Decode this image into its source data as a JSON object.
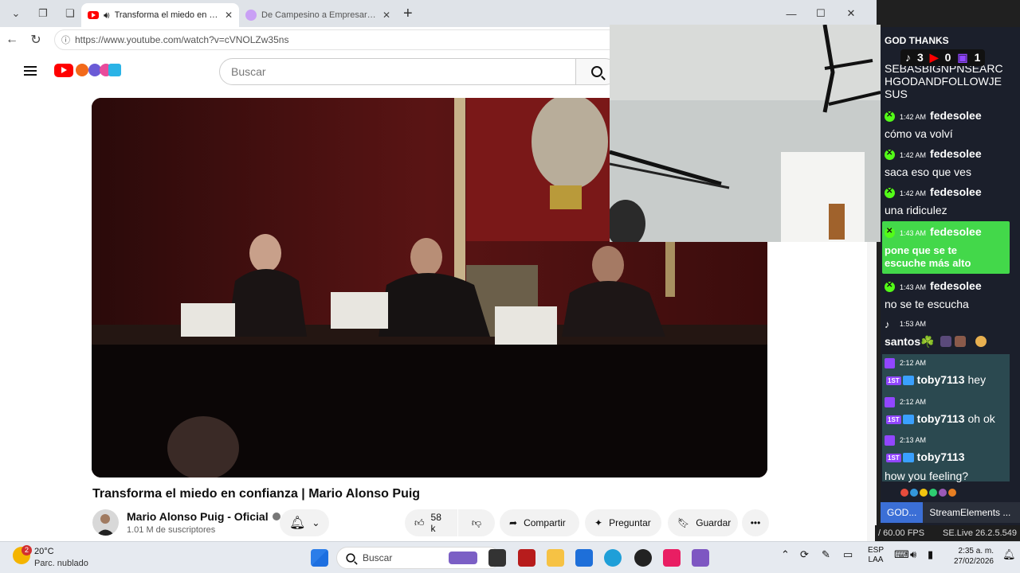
{
  "browser": {
    "tabs": [
      {
        "title": "Transforma el miedo en confi",
        "active": true
      },
      {
        "title": "De Campesino a Empresario- cóm",
        "active": false
      }
    ],
    "url": "https://www.youtube.com/watch?v=cVNOLZw35ns"
  },
  "youtube": {
    "search_placeholder": "Buscar",
    "video_title": "Transforma el miedo en confianza | Mario Alonso Puig",
    "channel_name": "Mario Alonso Puig - Oficial",
    "subscribers": "1.01 M de suscriptores",
    "likes": "58 k",
    "share_label": "Compartir",
    "ask_label": "Preguntar",
    "save_label": "Guardar"
  },
  "overlay": {
    "counters": {
      "tiktok": "3",
      "youtube": "0",
      "twitch": "1"
    },
    "header_text": "GOD THANKS",
    "partial_text": [
      "SEBASBIGNPNSEARC",
      "HGODANDFOLLOWJE",
      "SUS"
    ],
    "messages": [
      {
        "platform": "kick",
        "time": "1:42 AM",
        "user": "fedesolee",
        "text": "cómo va volví"
      },
      {
        "platform": "kick",
        "time": "1:42 AM",
        "user": "fedesolee",
        "text": "saca eso que ves"
      },
      {
        "platform": "kick",
        "time": "1:42 AM",
        "user": "fedesolee",
        "text": "una ridiculez"
      },
      {
        "platform": "kick",
        "time": "1:43 AM",
        "user": "fedesolee",
        "text1": "pone que se te",
        "text2": "escuche más alto"
      },
      {
        "platform": "kick",
        "time": "1:43 AM",
        "user": "fedesolee",
        "text": "no se te escucha"
      },
      {
        "platform": "tiktok",
        "time": "1:53 AM",
        "user": "santos☘️"
      },
      {
        "platform": "twitch",
        "time": "2:12 AM",
        "user": "toby7113",
        "text": "hey"
      },
      {
        "platform": "twitch",
        "time": "2:12 AM",
        "user": "toby7113",
        "text": "oh ok"
      },
      {
        "platform": "twitch",
        "time": "2:13 AM",
        "user": "toby7113",
        "text": "how you feeling?"
      }
    ],
    "badge_first": "1ST",
    "docks": [
      "GOD...",
      "StreamElements ..."
    ],
    "fps": "/ 60.00 FPS",
    "version": "SE.Live 26.2.5.549"
  },
  "taskbar": {
    "weather_temp": "20°C",
    "weather_desc": "Parc. nublado",
    "weather_badge": "2",
    "search_placeholder": "Buscar",
    "lang1": "ESP",
    "lang2": "LAA",
    "time": "2:35 a. m.",
    "date": "27/02/2026"
  }
}
